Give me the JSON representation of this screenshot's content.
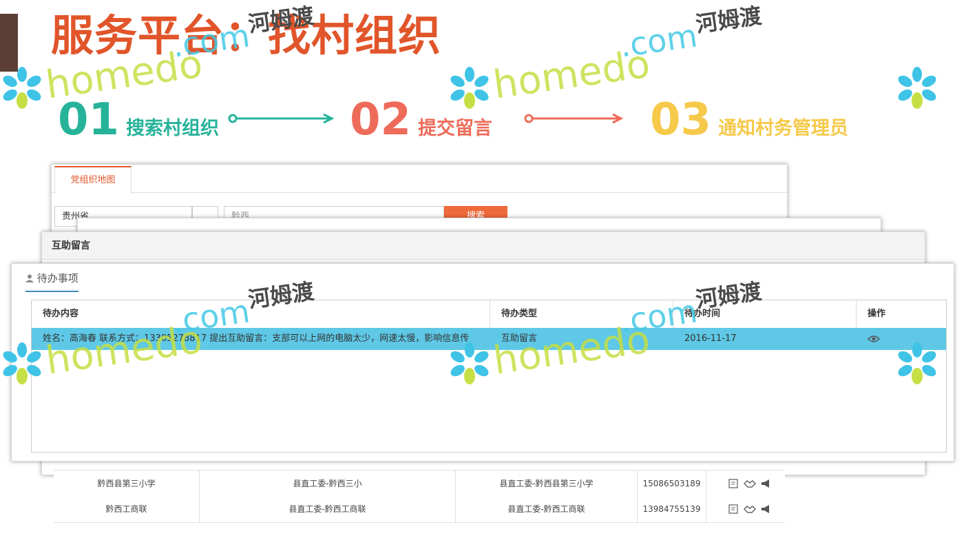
{
  "page": {
    "title": "服务平台：找村组织"
  },
  "watermark": {
    "text_latin": "homedo",
    "text_domain": ".com",
    "text_cn": "河姆渡"
  },
  "steps": [
    {
      "number": "01",
      "label": "搜索村组织",
      "color": "#27b39a"
    },
    {
      "number": "02",
      "label": "提交留言",
      "color": "#ee6b5a"
    },
    {
      "number": "03",
      "label": "通知村务管理员",
      "color": "#f6c94a"
    }
  ],
  "map_panel": {
    "tab_label": "党组织地图",
    "region_select": "贵州省",
    "search_placeholder": "黔西",
    "search_button": "搜索"
  },
  "help_panel": {
    "title": "互助留言"
  },
  "todo_panel": {
    "title": "待办事项",
    "columns": [
      "待办内容",
      "待办类型",
      "待办时间",
      "操作"
    ],
    "rows": [
      {
        "content": "姓名：高海春 联系方式：13305278817 提出互助留言：支部可以上网的电脑太少，网速太慢，影响信息传",
        "type": "互助留言",
        "time": "2016-11-17",
        "action_icon": "eye-icon"
      }
    ]
  },
  "org_table": {
    "rows": [
      {
        "name": "黔西县第三小学",
        "short": "县直工委-黔西三小",
        "full": "县直工委-黔西县第三小学",
        "phone": "15086503189"
      },
      {
        "name": "黔西工商联",
        "short": "县直工委-黔西工商联",
        "full": "县直工委-黔西工商联",
        "phone": "13984755139"
      }
    ],
    "row_icons": [
      "edit-icon",
      "handshake-icon",
      "megaphone-icon"
    ]
  },
  "colors": {
    "title": "#e1552a",
    "selected_row": "#5ec8e6",
    "tab_accent": "#e1552a"
  }
}
